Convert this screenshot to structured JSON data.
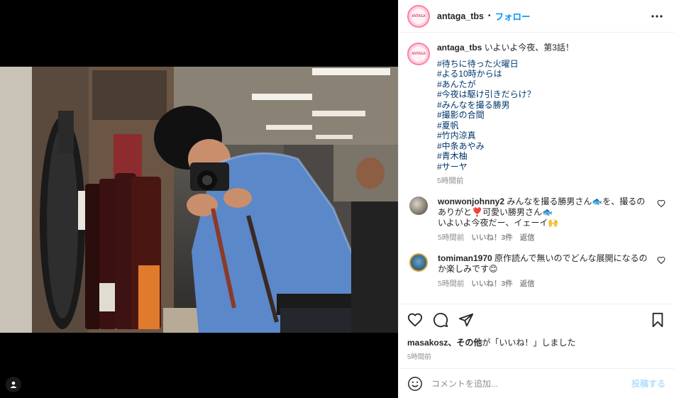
{
  "header": {
    "username": "antaga_tbs",
    "separator": "•",
    "follow_label": "フォロー",
    "more_icon": "more-horizontal-icon",
    "avatar_text": "ANTAGA"
  },
  "caption": {
    "username": "antaga_tbs",
    "text": "いよいよ今夜、第3話！",
    "hashtags": [
      "#待ちに待った火曜日",
      "#よる10時からは",
      "#あんたが",
      "#今夜は駆け引きだらけ？",
      "#みんなを撮る勝男",
      "#撮影の合間",
      "#夏帆",
      "#竹内涼真",
      "#中条あやみ",
      "#青木柚",
      "#サーヤ"
    ],
    "time": "5時間前"
  },
  "comments": [
    {
      "username": "wonwonjohnny2",
      "line1": "みんなを撮る勝男さん🐟を、撮るのありがと❣️可愛い勝男さん🐟",
      "line2": "いよいよ今夜だー、イェーイ🙌",
      "time": "5時間前",
      "likes": "いいね！3件",
      "reply": "返信"
    },
    {
      "username": "tomiman1970",
      "line1": "原作読んで無いのでどんな展開になるのか楽しみです😊",
      "line2": "",
      "time": "5時間前",
      "likes": "いいね！3件",
      "reply": "返信"
    }
  ],
  "likes_line": {
    "user": "masakosz",
    "others": "その他",
    "suffix": "が「いいね！」しました"
  },
  "post_time": "5時間前",
  "add_comment": {
    "placeholder": "コメントを追加...",
    "post_label": "投稿する"
  },
  "colors": {
    "link": "#0095f6",
    "hashtag": "#00376b",
    "muted": "#8e8e8e"
  }
}
